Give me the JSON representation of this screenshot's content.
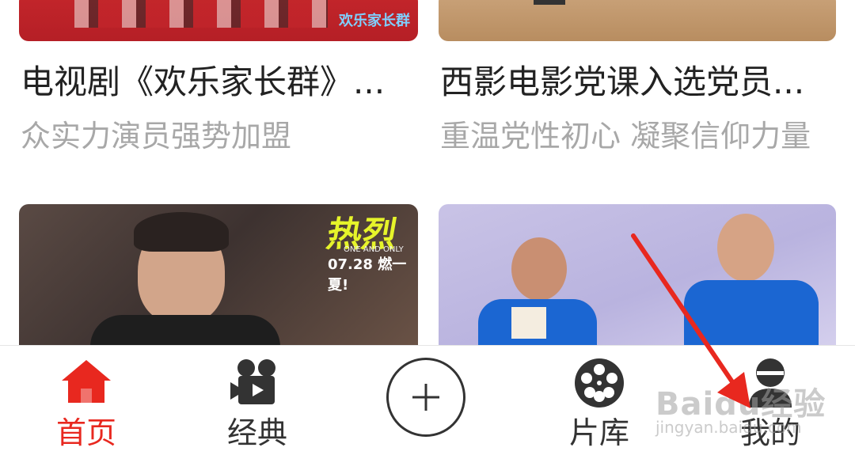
{
  "cards": [
    {
      "title": "电视剧《欢乐家长群》...",
      "subtitle": "众实力演员强势加盟"
    },
    {
      "title": "西影电影党课入选党员...",
      "subtitle": "重温党性初心 凝聚信仰力量"
    }
  ],
  "posters": [
    {
      "overlay_title": "热烈",
      "overlay_sub": "ONE AND ONLY",
      "overlay_date": "07.28 燃一夏!"
    },
    {
      "overlay_title": ""
    }
  ],
  "thumb_text": {
    "left_logo": "欢乐家长群"
  },
  "tabs": [
    {
      "label": "首页",
      "icon": "home-icon",
      "active": true
    },
    {
      "label": "经典",
      "icon": "video-camera-icon",
      "active": false
    },
    {
      "label": "",
      "icon": "plus-icon",
      "active": false
    },
    {
      "label": "片库",
      "icon": "film-reel-icon",
      "active": false
    },
    {
      "label": "我的",
      "icon": "user-icon",
      "active": false
    }
  ],
  "watermark": {
    "text": "Baidu经验",
    "sub": "jingyan.baidu.com"
  },
  "colors": {
    "accent": "#e8281f",
    "text": "#222222",
    "muted": "#a8a8a8"
  }
}
